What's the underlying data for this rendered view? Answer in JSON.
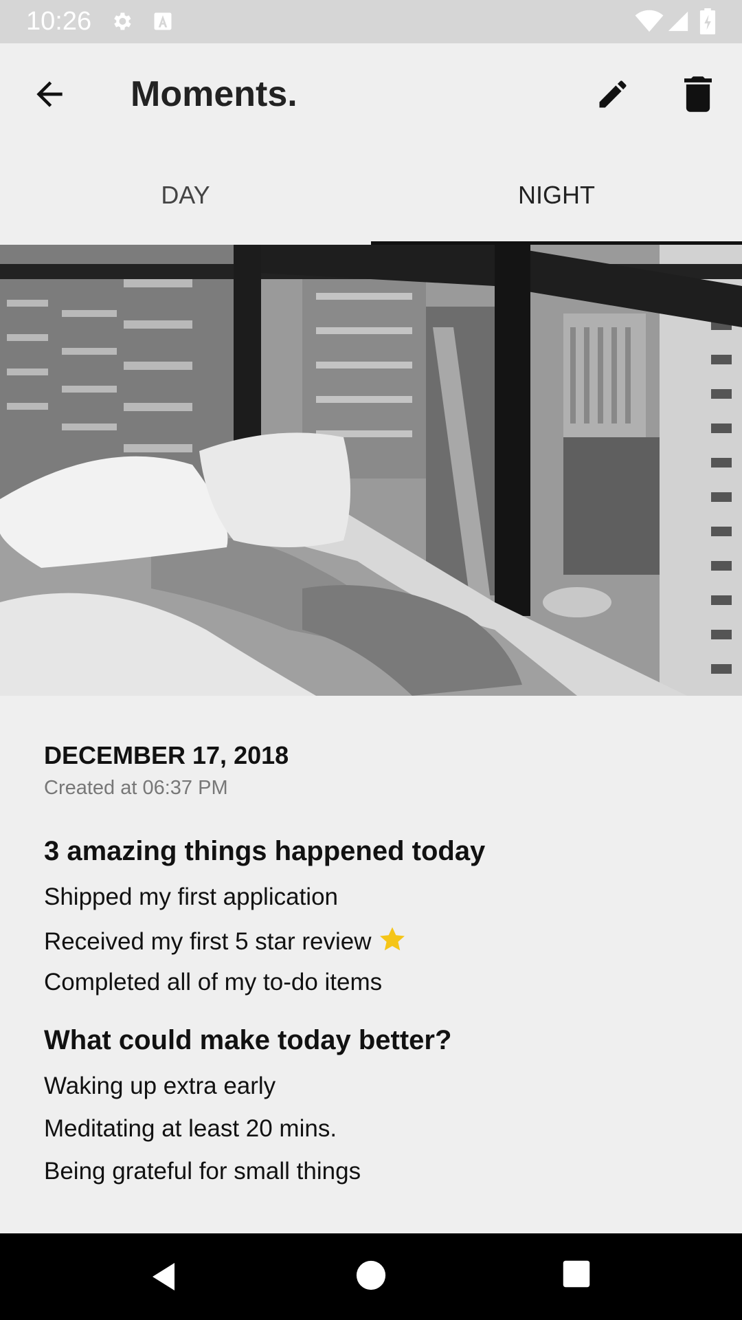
{
  "status_bar": {
    "time": "10:26",
    "icons": [
      "gear-icon",
      "font-a-icon",
      "wifi-icon",
      "signal-icon",
      "battery-icon"
    ]
  },
  "app_bar": {
    "title": "Moments.",
    "icons": [
      "back-arrow-icon",
      "pencil-icon",
      "trash-icon"
    ]
  },
  "tabs": [
    {
      "label": "DAY",
      "selected": false
    },
    {
      "label": "NIGHT",
      "selected": true
    }
  ],
  "entry": {
    "date": "DECEMBER 17, 2018",
    "created": "Created at 06:37 PM",
    "sections": [
      {
        "title": "3 amazing things happened today",
        "items": [
          "Shipped my first application",
          "Received my first 5 star review",
          "Completed all of my to-do items"
        ]
      },
      {
        "title": "What could make today better?",
        "items": [
          "Waking up extra early",
          "Meditating at least 20 mins.",
          "Being grateful for small things"
        ]
      }
    ]
  },
  "colors": {
    "background": "#efefef",
    "status_bar": "#d6d6d6",
    "nav_bar": "#000000",
    "star": "#f5c518"
  },
  "nav": [
    "nav-back-icon",
    "nav-home-icon",
    "nav-recents-icon"
  ]
}
